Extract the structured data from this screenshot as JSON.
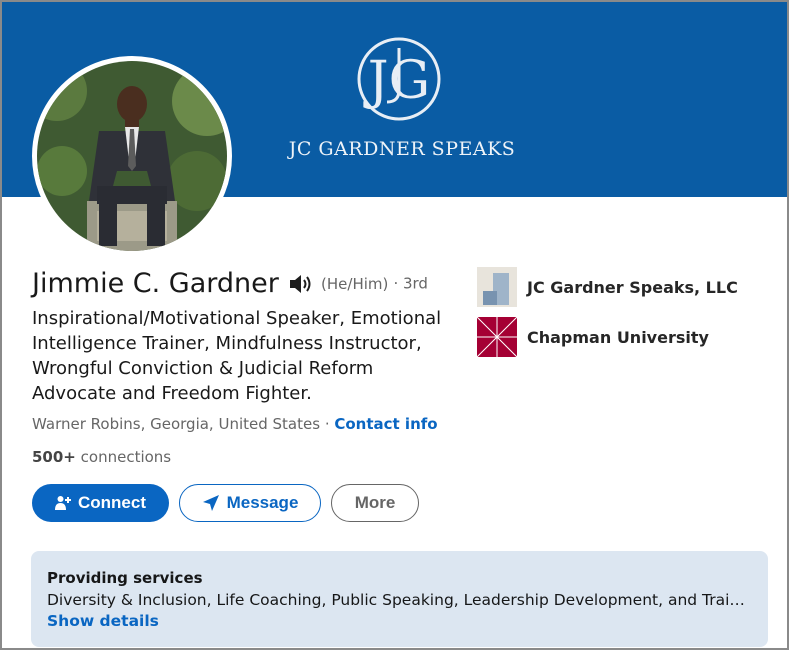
{
  "banner": {
    "monogram": "JG",
    "brand_text": "JC GARDNER SPEAKS",
    "background_color": "#0a5ca4"
  },
  "profile": {
    "name": "Jimmie C. Gardner",
    "pronunciation_icon": "speaker-icon",
    "pronouns": "(He/Him)",
    "degree": "· 3rd",
    "headline": "Inspirational/Motivational Speaker, Emotional Intelligence Trainer, Mindfulness Instructor, Wrongful Conviction & Judicial Reform Advocate and Freedom Fighter.",
    "location": "Warner Robins, Georgia, United States",
    "location_separator": " · ",
    "contact_info_label": "Contact info",
    "connections_count": "500+",
    "connections_label": " connections"
  },
  "actions": {
    "connect_label": "Connect",
    "message_label": "Message",
    "more_label": "More"
  },
  "organizations": [
    {
      "name": "JC Gardner Speaks, LLC",
      "icon": "company-logo-icon"
    },
    {
      "name": "Chapman University",
      "icon": "university-logo-icon"
    }
  ],
  "services": {
    "title": "Providing services",
    "list": "Diversity & Inclusion, Life Coaching, Public Speaking, Leadership Development, and Training",
    "show_details_label": "Show details"
  },
  "colors": {
    "accent": "#0a66c2",
    "services_bg": "#dce6f1",
    "chapman_red": "#a50034"
  }
}
